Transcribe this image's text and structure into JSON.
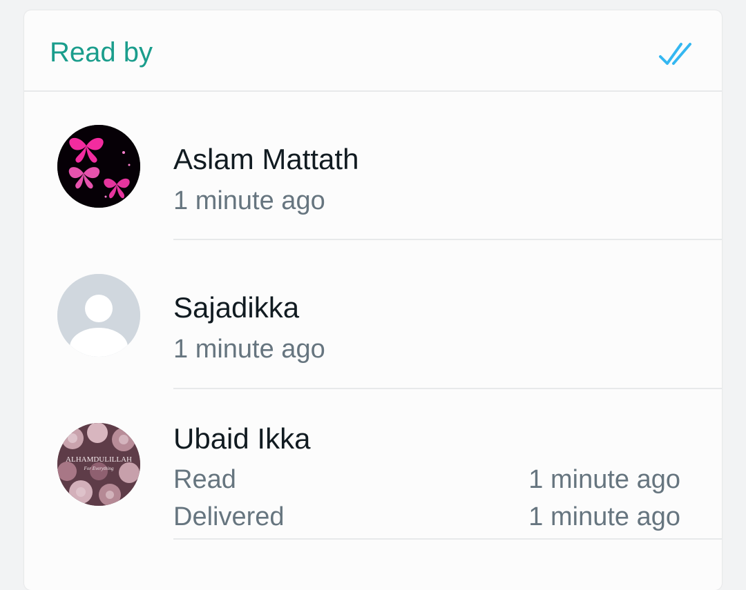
{
  "header": {
    "title": "Read by",
    "status_icon": "double-check-icon",
    "accent_color": "#1a9d8c",
    "check_color": "#34b7f1"
  },
  "receipts": [
    {
      "name": "Aslam Mattath",
      "time": "1 minute ago",
      "avatar": "butterfly-avatar"
    },
    {
      "name": "Sajadikka",
      "time": "1 minute ago",
      "avatar": "default-person-avatar"
    },
    {
      "name": "Ubaid Ikka",
      "avatar": "roses-avatar",
      "avatar_text": "ALHAMDULILLAH",
      "avatar_subtext": "For Everything",
      "read_label": "Read",
      "read_time": "1 minute ago",
      "delivered_label": "Delivered",
      "delivered_time": "1 minute ago"
    }
  ]
}
